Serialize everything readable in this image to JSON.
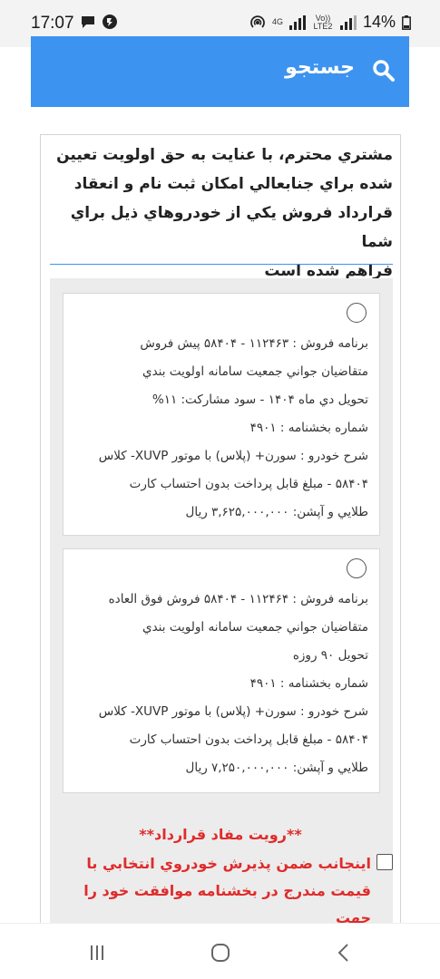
{
  "status_bar": {
    "time": "17:07",
    "network_4g": "4G",
    "network_volte": "Vo)) LTE2",
    "battery": "14%"
  },
  "header": {
    "title": "جستجو",
    "icon": "search-icon"
  },
  "intro": {
    "lines": [
      "مشتري محترم، با عنايت به حق اولويت تعيين",
      "شده براي جنابعالي امكان ثبت نام و انعقاد",
      "قرارداد فروش يكي از خودروهاي ذيل براي شما",
      "فراهم شده است"
    ]
  },
  "options": [
    {
      "lines": [
        "برنامه فروش : ۱۱۲۴۶۳ - ۵۸۴۰۴ پيش فروش",
        "متقاضيان جواني جمعيت سامانه اولويت بندي",
        "تحويل دي ماه ۱۴۰۴ - سود مشاركت: ۱۱%",
        "شماره بخشنامه : ۴۹۰۱",
        "شرح خودرو : سورن+ (پلاس) با موتور XUVP- كلاس",
        "۵۸۴۰۴ - مبلغ قابل پرداخت بدون احتساب كارت",
        "طلايي و آپشن: ۳,۶۲۵,۰۰۰,۰۰۰ ريال"
      ]
    },
    {
      "lines": [
        "برنامه فروش : ۱۱۲۴۶۴ - ۵۸۴۰۴ فروش فوق العاده",
        "متقاضيان جواني جمعيت سامانه اولويت بندي",
        "تحويل ۹۰ روزه",
        "شماره بخشنامه : ۴۹۰۱",
        "شرح خودرو : سورن+ (پلاس) با موتور XUVP- كلاس",
        "۵۸۴۰۴ - مبلغ قابل پرداخت بدون احتساب كارت",
        "طلايي و آپشن: ۷,۲۵۰,۰۰۰,۰۰۰ ريال"
      ]
    }
  ],
  "notice": {
    "title": "**رويت مفاد قرارداد**",
    "lines": [
      "اينجانب ضمن پذيرش خودروي انتخابي با",
      "قيمت مندرج در بخشنامه موافقت خود را جهت"
    ]
  },
  "colors": {
    "header_bg": "#3d93f0",
    "notice_red": "#e02b2b"
  },
  "nav_icons": [
    "recent-apps-icon",
    "home-icon",
    "back-icon"
  ]
}
